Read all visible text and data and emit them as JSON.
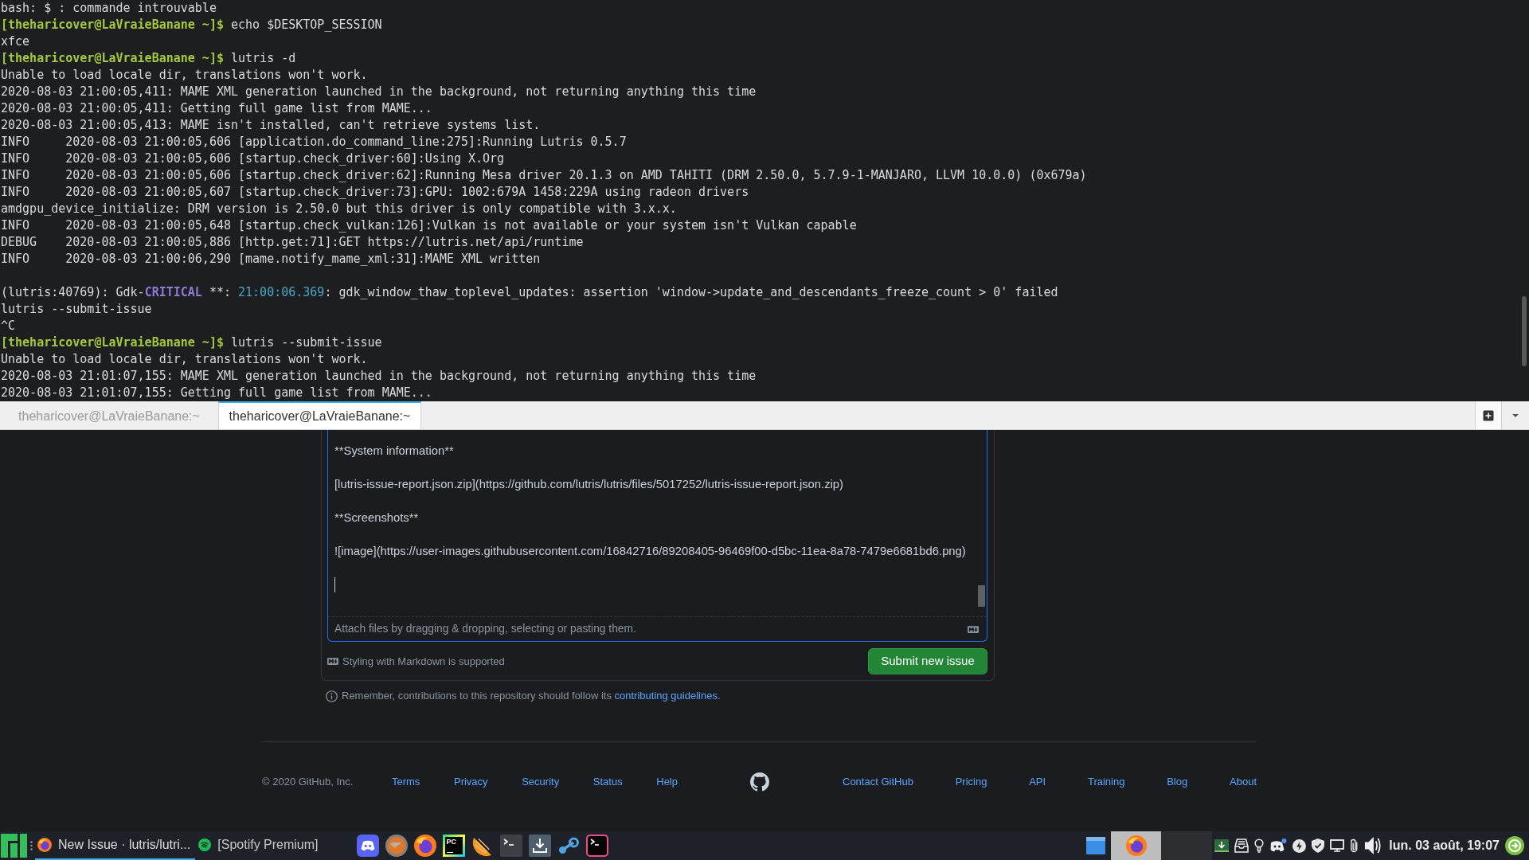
{
  "terminal": {
    "lines": [
      {
        "kind": "output",
        "text": "bash: $ : commande introuvable"
      },
      {
        "kind": "prompt",
        "prompt": "[theharicover@LaVraieBanane ~]$",
        "command": "echo $DESKTOP_SESSION"
      },
      {
        "kind": "output",
        "text": "xfce"
      },
      {
        "kind": "prompt",
        "prompt": "[theharicover@LaVraieBanane ~]$",
        "command": "lutris -d"
      },
      {
        "kind": "output",
        "text": "Unable to load locale dir, translations won't work."
      },
      {
        "kind": "output",
        "text": "2020-08-03 21:00:05,411: MAME XML generation launched in the background, not returning anything this time"
      },
      {
        "kind": "output",
        "text": "2020-08-03 21:00:05,411: Getting full game list from MAME..."
      },
      {
        "kind": "output",
        "text": "2020-08-03 21:00:05,413: MAME isn't installed, can't retrieve systems list."
      },
      {
        "kind": "output",
        "text": "INFO     2020-08-03 21:00:05,606 [application.do_command_line:275]:Running Lutris 0.5.7"
      },
      {
        "kind": "output",
        "text": "INFO     2020-08-03 21:00:05,606 [startup.check_driver:60]:Using X.Org"
      },
      {
        "kind": "output",
        "text": "INFO     2020-08-03 21:00:05,606 [startup.check_driver:62]:Running Mesa driver 20.1.3 on AMD TAHITI (DRM 2.50.0, 5.7.9-1-MANJARO, LLVM 10.0.0) (0x679a)"
      },
      {
        "kind": "output",
        "text": "INFO     2020-08-03 21:00:05,607 [startup.check_driver:73]:GPU: 1002:679A 1458:229A using radeon drivers"
      },
      {
        "kind": "output",
        "text": "amdgpu_device_initialize: DRM version is 2.50.0 but this driver is only compatible with 3.x.x."
      },
      {
        "kind": "output",
        "text": "INFO     2020-08-03 21:00:05,648 [startup.check_vulkan:126]:Vulkan is not available or your system isn't Vulkan capable"
      },
      {
        "kind": "output",
        "text": "DEBUG    2020-08-03 21:00:05,886 [http.get:71]:GET https://lutris.net/api/runtime"
      },
      {
        "kind": "output",
        "text": "INFO     2020-08-03 21:00:06,290 [mame.notify_mame_xml:31]:MAME XML written"
      },
      {
        "kind": "blank"
      },
      {
        "kind": "segments",
        "segments": [
          {
            "kind": "plain",
            "text": "(lutris:40769): Gdk-"
          },
          {
            "kind": "critical",
            "text": "CRITICAL"
          },
          {
            "kind": "plain",
            "text": " **: "
          },
          {
            "kind": "timestamp",
            "text": "21:00:06.369"
          },
          {
            "kind": "plain",
            "text": ": gdk_window_thaw_toplevel_updates: assertion 'window->update_and_descendants_freeze_count > 0' failed"
          }
        ]
      },
      {
        "kind": "output",
        "text": "lutris --submit-issue"
      },
      {
        "kind": "output",
        "text": "^C"
      },
      {
        "kind": "prompt",
        "prompt": "[theharicover@LaVraieBanane ~]$",
        "command": "lutris --submit-issue"
      },
      {
        "kind": "output",
        "text": "Unable to load locale dir, translations won't work."
      },
      {
        "kind": "output",
        "text": "2020-08-03 21:01:07,155: MAME XML generation launched in the background, not returning anything this time"
      },
      {
        "kind": "output",
        "text": "2020-08-03 21:01:07,155: Getting full game list from MAME..."
      }
    ]
  },
  "terminal_tabs": [
    {
      "label": "theharicover@LaVraieBanane:~",
      "selected": false
    },
    {
      "label": "theharicover@LaVraieBanane:~",
      "selected": true
    }
  ],
  "issue_form": {
    "body_lines": [
      "**System information**",
      "[lutris-issue-report.json.zip](https://github.com/lutris/lutris/files/5017252/lutris-issue-report.json.zip)",
      "**Screenshots**",
      "![image](https://user-images.githubusercontent.com/16842716/89208405-96469f00-d5bc-11ea-8a78-7479e6681bd6.png)"
    ],
    "attach_hint": "Attach files by dragging & dropping, selecting or pasting them.",
    "markdown_note": "Styling with Markdown is supported",
    "submit_label": "Submit new issue",
    "guidelines": {
      "text": "Remember, contributions to this repository should follow its",
      "link": "contributing guidelines",
      "end": "."
    }
  },
  "footer": {
    "copyright": "© 2020 GitHub, Inc.",
    "links_left": [
      "Terms",
      "Privacy",
      "Security",
      "Status",
      "Help"
    ],
    "links_right": [
      "Contact GitHub",
      "Pricing",
      "API",
      "Training",
      "Blog",
      "About"
    ]
  },
  "taskbar": {
    "tasks": [
      {
        "kind": "browser",
        "label": "New Issue · lutris/lutri...",
        "selected": true
      },
      {
        "kind": "music",
        "label": "[Spotify Premium]",
        "selected": false
      }
    ],
    "ide_icon_text": "PC",
    "workspaces": [
      {
        "selected": true,
        "occupied": true
      },
      {
        "selected": false,
        "occupied": false
      }
    ],
    "clock": "lun. 03 août, 19:07"
  }
}
